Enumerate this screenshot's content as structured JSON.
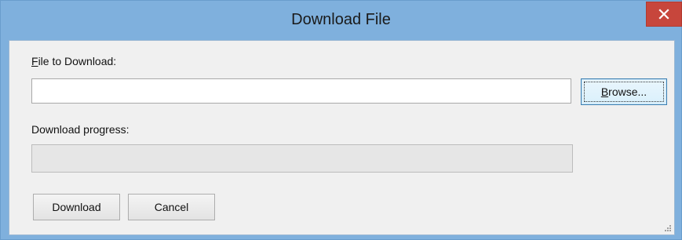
{
  "window": {
    "title": "Download File"
  },
  "form": {
    "file_label_first": "F",
    "file_label_rest": "ile to Download:",
    "file_value": "",
    "browse_label_first": "B",
    "browse_label_rest": "rowse...",
    "progress_label": "Download progress:",
    "progress_value": 0
  },
  "buttons": {
    "download": "Download",
    "cancel": "Cancel"
  },
  "icons": {
    "close": "close-icon",
    "grip": "resize-grip-icon"
  },
  "colors": {
    "titlebar": "#7fb0dd",
    "close": "#c7463c",
    "client": "#f0f0f0"
  }
}
